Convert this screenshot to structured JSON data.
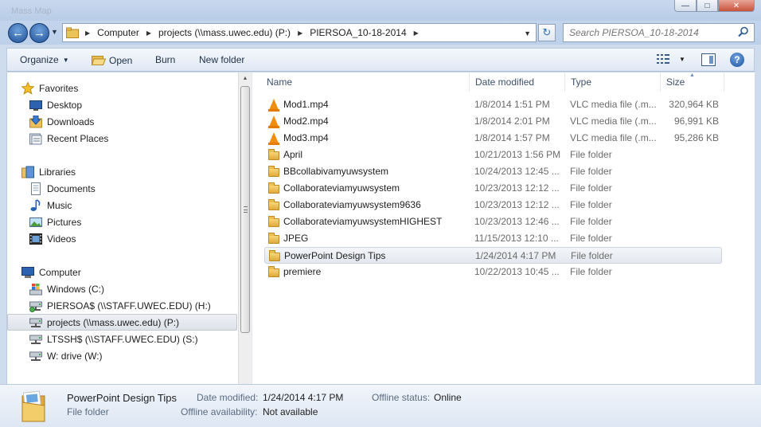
{
  "window": {
    "faint_title": "Mass Map",
    "controls": {
      "minimize": "—",
      "maximize": "□",
      "close": "✕"
    }
  },
  "address_bar": {
    "crumbs": [
      "Computer",
      "projects (\\\\mass.uwec.edu) (P:)",
      "PIERSOA_10-18-2014"
    ]
  },
  "search": {
    "placeholder": "Search PIERSOA_10-18-2014"
  },
  "toolbar": {
    "organize": "Organize",
    "open": "Open",
    "burn": "Burn",
    "new_folder": "New folder"
  },
  "nav_pane": {
    "favorites": {
      "header": "Favorites",
      "items": [
        "Desktop",
        "Downloads",
        "Recent Places"
      ]
    },
    "libraries": {
      "header": "Libraries",
      "items": [
        "Documents",
        "Music",
        "Pictures",
        "Videos"
      ]
    },
    "computer": {
      "header": "Computer",
      "items": [
        "Windows (C:)",
        "PIERSOA$ (\\\\STAFF.UWEC.EDU) (H:)",
        "projects (\\\\mass.uwec.edu) (P:)",
        "LTSSH$ (\\\\STAFF.UWEC.EDU) (S:)",
        "W: drive (W:)"
      ]
    }
  },
  "columns": {
    "name": "Name",
    "date": "Date modified",
    "type": "Type",
    "size": "Size"
  },
  "files": [
    {
      "name": "Mod1.mp4",
      "date": "1/8/2014 1:51 PM",
      "type": "VLC media file (.m...",
      "size": "320,964 KB",
      "icon": "vlc-icon"
    },
    {
      "name": "Mod2.mp4",
      "date": "1/8/2014 2:01 PM",
      "type": "VLC media file (.m...",
      "size": "96,991 KB",
      "icon": "vlc-icon"
    },
    {
      "name": "Mod3.mp4",
      "date": "1/8/2014 1:57 PM",
      "type": "VLC media file (.m...",
      "size": "95,286 KB",
      "icon": "vlc-icon"
    },
    {
      "name": "April",
      "date": "10/21/2013 1:56 PM",
      "type": "File folder",
      "size": "",
      "icon": "folder-icon"
    },
    {
      "name": "BBcollabivamyuwsystem",
      "date": "10/24/2013 12:45 ...",
      "type": "File folder",
      "size": "",
      "icon": "folder-icon"
    },
    {
      "name": "Collaborateviamyuwsystem",
      "date": "10/23/2013 12:12 ...",
      "type": "File folder",
      "size": "",
      "icon": "folder-icon"
    },
    {
      "name": "Collaborateviamyuwsystem9636",
      "date": "10/23/2013 12:12 ...",
      "type": "File folder",
      "size": "",
      "icon": "folder-icon"
    },
    {
      "name": "CollaborateviamyuwsystemHIGHEST",
      "date": "10/23/2013 12:46 ...",
      "type": "File folder",
      "size": "",
      "icon": "folder-icon"
    },
    {
      "name": "JPEG",
      "date": "11/15/2013 12:10 ...",
      "type": "File folder",
      "size": "",
      "icon": "folder-icon"
    },
    {
      "name": "PowerPoint Design Tips",
      "date": "1/24/2014 4:17 PM",
      "type": "File folder",
      "size": "",
      "icon": "folder-icon"
    },
    {
      "name": "premiere",
      "date": "10/22/2013 10:45 ...",
      "type": "File folder",
      "size": "",
      "icon": "folder-icon"
    }
  ],
  "selected_index": 9,
  "details": {
    "name": "PowerPoint Design Tips",
    "kind": "File folder",
    "date_label": "Date modified:",
    "date_value": "1/24/2014 4:17 PM",
    "offline_status_label": "Offline status:",
    "offline_status_value": "Online",
    "availability_label": "Offline availability:",
    "availability_value": "Not available"
  },
  "colors": {
    "chrome": "#cfdcee",
    "selection": "#e3e7ee",
    "folder": "#e0a93a",
    "vlc": "#f08d0f",
    "nav_blue": "#1f4f95"
  }
}
